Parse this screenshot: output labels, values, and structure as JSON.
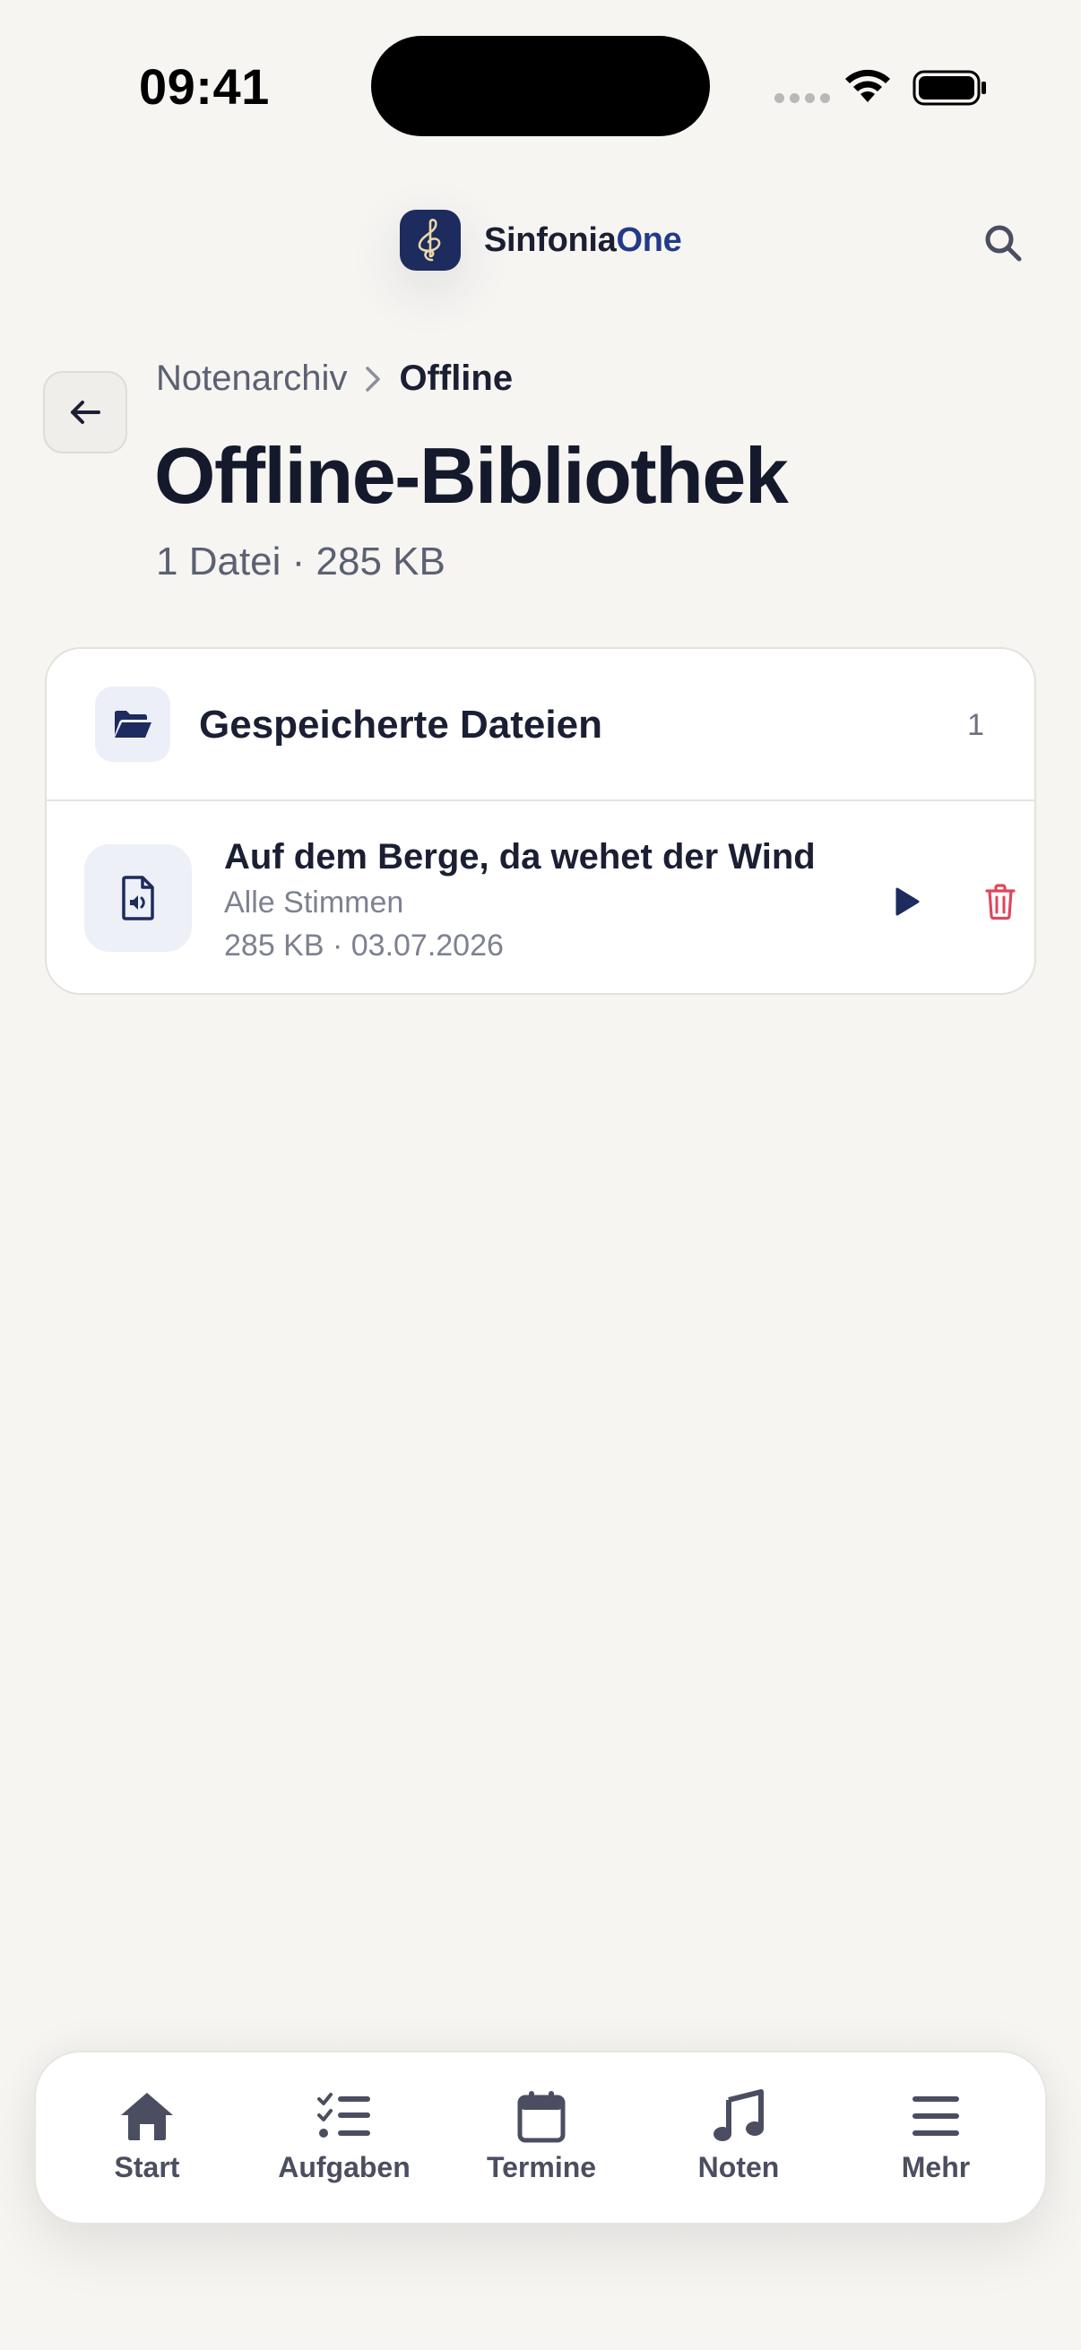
{
  "status": {
    "time": "09:41"
  },
  "header": {
    "app_name": "Sinfonia",
    "app_name_accent": "One"
  },
  "breadcrumb": {
    "parent": "Notenarchiv",
    "current": "Offline"
  },
  "page": {
    "title": "Offline-Bibliothek",
    "subtitle": "1 Datei · 285 KB"
  },
  "card": {
    "title": "Gespeicherte Dateien",
    "count": "1",
    "files": [
      {
        "title": "Auf dem Berge, da wehet der Wind",
        "voice": "Alle Stimmen",
        "meta": "285 KB · 03.07.2026"
      }
    ]
  },
  "tabbar": {
    "items": [
      {
        "label": "Start",
        "icon": "home-icon"
      },
      {
        "label": "Aufgaben",
        "icon": "checklist-icon"
      },
      {
        "label": "Termine",
        "icon": "calendar-icon"
      },
      {
        "label": "Noten",
        "icon": "music-note-icon"
      },
      {
        "label": "Mehr",
        "icon": "menu-icon"
      }
    ]
  },
  "colors": {
    "accent": "#223a8a",
    "danger": "#e0465a",
    "background": "#f6f5f2"
  }
}
